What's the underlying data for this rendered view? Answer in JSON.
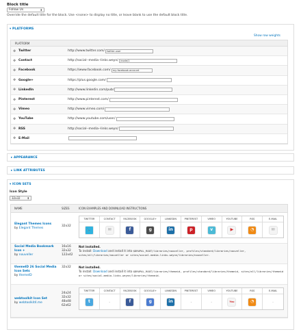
{
  "block_title": {
    "label": "Block title",
    "value": "Follow Us",
    "description": "Override the default title for the block. Use <none> to display no title, or leave blank to use the default block title."
  },
  "platforms": {
    "legend": "▾ PLATFORMS",
    "show_weights": "Show row weights",
    "column_header": "PLATFORM",
    "rows": [
      {
        "name": "Twitter",
        "prefix": "http://www.twitter.com/",
        "value": "twitter-user"
      },
      {
        "name": "Contact",
        "prefix": "http://social--media--links.weyn/",
        "value": "/node/1"
      },
      {
        "name": "Facebook",
        "prefix": "https://www.facebook.com/",
        "value": "my-facebook-account"
      },
      {
        "name": "Google+",
        "prefix": "https://plus.google.com/",
        "value": ""
      },
      {
        "name": "LinkedIn",
        "prefix": "http://www.linkedin.com/pub/",
        "value": ""
      },
      {
        "name": "Pinterest",
        "prefix": "http://www.pinterest.com/",
        "value": ""
      },
      {
        "name": "Vimeo",
        "prefix": "http://www.vimeo.com/",
        "value": ""
      },
      {
        "name": "YouTube",
        "prefix": "http://www.youtube.com/user/",
        "value": ""
      },
      {
        "name": "RSS",
        "prefix": "http://social--media--links.weyn/",
        "value": ""
      },
      {
        "name": "E-Mail",
        "prefix": "",
        "value": ""
      }
    ]
  },
  "appearance": {
    "legend": "▸ APPEARANCE"
  },
  "link_attributes": {
    "legend": "▸ LINK ATTRIBUTES"
  },
  "icon_sets": {
    "legend": "▾ ICON SETS",
    "style_label": "Icon Style",
    "style_value": "32x32",
    "headers": {
      "name": "NAME",
      "sizes": "SIZES",
      "examples": "ICON EXAMPLES AND DOWNLOAD INSTRUCTIONS"
    },
    "example_headers": [
      "TWITTER",
      "CONTACT",
      "FACEBOOK",
      "GOOGLE+",
      "LINKEDIN",
      "PINTEREST",
      "VIMEO",
      "YOUTUBE",
      "RSS",
      "E-MAIL"
    ],
    "sets": [
      {
        "name": "Elegant Themes Icons",
        "by": "by",
        "author": "Elegant Themes",
        "sizes": "32x32"
      },
      {
        "name": "Social Media Bookmark Icon +",
        "by": "by",
        "author": "nouveller",
        "sizes": "16x16\n32x32\n122x42",
        "status": "Not installed.",
        "instr_a": "To install: ",
        "download": "Download",
        "instr_b": " and install it into ",
        "path": "$DRUPAL_ROOT/libraries/nouveller, profiles/standard/libraries/nouveller, sites/all/libraries/nouveller or sites/social-media-links.weynn/libraries/nouveller."
      },
      {
        "name": "themeID 26 Social Media Icon Sets",
        "by": "by",
        "author": "themeID",
        "sizes": "32x32",
        "status": "Not installed.",
        "instr_a": "To install: ",
        "download": "Download",
        "instr_b": " and install it into ",
        "path": "$DRUPAL_ROOT/libraries/themeid, profiles/standard/libraries/themeid, sites/all/libraries/themeid or sites/social-media-links.weynn/libraries/themeid."
      },
      {
        "name": "webtoolkit Icon Set",
        "by": "by",
        "author": "webtoolkit4.me",
        "sizes": "24x24\n32x32\n48x48\n62x62",
        "dash": "-"
      }
    ]
  },
  "colors": {
    "link": "#0074bd",
    "twitter": "#2fb3df",
    "facebook": "#3a5a98",
    "googleplus": "#4a4a4a",
    "linkedin": "#1c6fa8",
    "pinterest": "#cc2127",
    "vimeo": "#4bbad6",
    "youtube": "#d23131",
    "rss": "#f08a14"
  }
}
